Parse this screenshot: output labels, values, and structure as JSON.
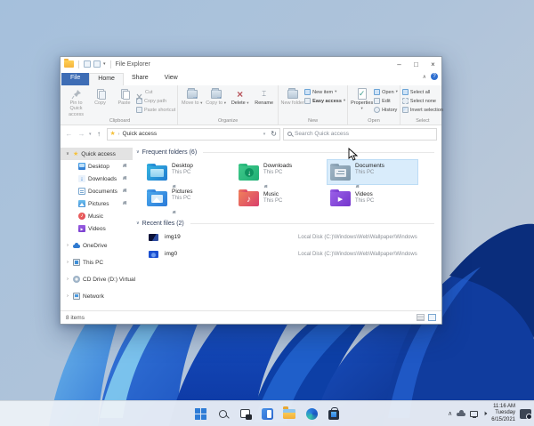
{
  "glyphs": {
    "collapse": "∨",
    "expand": "›",
    "dropdown": "▾",
    "back": "←",
    "forward": "→",
    "up": "↑",
    "refresh": "↻",
    "minimize": "–",
    "maximize": "□",
    "close": "×",
    "ribbon_collapse": "∧",
    "help": "?",
    "star": "★",
    "tray_chevron": "∧",
    "down_arrow": "↓",
    "play": "▶",
    "note": "♪",
    "delete_x": "×",
    "check": "✓",
    "rename_beam": "I",
    "crumb": "›"
  },
  "explorer": {
    "title": "File Explorer",
    "tabs": {
      "file": "File",
      "home": "Home",
      "share": "Share",
      "view": "View"
    },
    "ribbon": {
      "clipboard": {
        "label": "Clipboard",
        "pin": "Pin to Quick access",
        "copy": "Copy",
        "paste": "Paste",
        "cut": "Cut",
        "copy_path": "Copy path",
        "paste_shortcut": "Paste shortcut"
      },
      "organize": {
        "label": "Organize",
        "move_to": "Move to",
        "copy_to": "Copy to",
        "delete": "Delete",
        "rename": "Rename"
      },
      "new": {
        "label": "New",
        "new_folder": "New folder",
        "new_item": "New item",
        "easy_access": "Easy access"
      },
      "open": {
        "label": "Open",
        "properties": "Properties",
        "open": "Open",
        "edit": "Edit",
        "history": "History"
      },
      "select": {
        "label": "Select",
        "select_all": "Select all",
        "select_none": "Select none",
        "invert": "Invert selection"
      }
    },
    "nav": {
      "address": "Quick access",
      "search_placeholder": "Search Quick access"
    },
    "sidebar": {
      "quick_access": "Quick access",
      "quick_children": [
        {
          "label": "Desktop"
        },
        {
          "label": "Downloads"
        },
        {
          "label": "Documents"
        },
        {
          "label": "Pictures"
        },
        {
          "label": "Music"
        },
        {
          "label": "Videos"
        }
      ],
      "groups": [
        {
          "label": "OneDrive"
        },
        {
          "label": "This PC"
        },
        {
          "label": "CD Drive (D:) Virtual"
        },
        {
          "label": "Network"
        }
      ]
    },
    "content": {
      "frequent_header": "Frequent folders (6)",
      "recent_header": "Recent files (2)",
      "tiles": [
        {
          "name": "Desktop",
          "location": "This PC"
        },
        {
          "name": "Downloads",
          "location": "This PC"
        },
        {
          "name": "Documents",
          "location": "This PC"
        },
        {
          "name": "Pictures",
          "location": "This PC"
        },
        {
          "name": "Music",
          "location": "This PC"
        },
        {
          "name": "Videos",
          "location": "This PC"
        }
      ],
      "recent": [
        {
          "name": "img19",
          "path": "Local Disk (C:)\\Windows\\Web\\Wallpaper\\Windows"
        },
        {
          "name": "img0",
          "path": "Local Disk (C:)\\Windows\\Web\\Wallpaper\\Windows"
        }
      ]
    },
    "status": {
      "items": "8 items"
    }
  },
  "taskbar": {
    "clock": {
      "time": "11:16 AM",
      "day": "Tuesday",
      "date": "6/15/2021"
    }
  }
}
